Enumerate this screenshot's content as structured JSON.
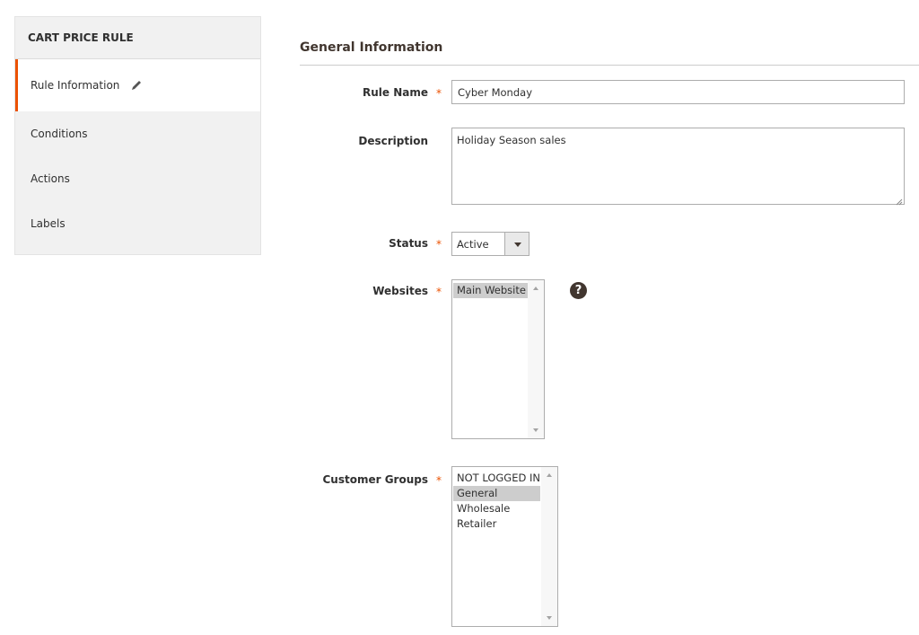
{
  "sidebar": {
    "title": "CART PRICE RULE",
    "items": [
      {
        "label": "Rule Information",
        "active": true
      },
      {
        "label": "Conditions"
      },
      {
        "label": "Actions"
      },
      {
        "label": "Labels"
      }
    ]
  },
  "section": {
    "title": "General Information"
  },
  "form": {
    "rule_name": {
      "label": "Rule Name",
      "value": "Cyber Monday"
    },
    "description": {
      "label": "Description",
      "value": "Holiday Season sales"
    },
    "status": {
      "label": "Status",
      "value": "Active"
    },
    "websites": {
      "label": "Websites",
      "options": [
        "Main Website"
      ],
      "selected": "Main Website"
    },
    "customer_groups": {
      "label": "Customer Groups",
      "options": [
        "NOT LOGGED IN",
        "General",
        "Wholesale",
        "Retailer"
      ],
      "selected": "General"
    }
  },
  "icons": {
    "edit": "pencil-icon",
    "help": "question-circle-icon",
    "help_glyph": "?"
  },
  "colors": {
    "accent": "#eb5202",
    "sidebar_bg": "#f1f1f1",
    "selected_option": "#cdcdcd"
  }
}
